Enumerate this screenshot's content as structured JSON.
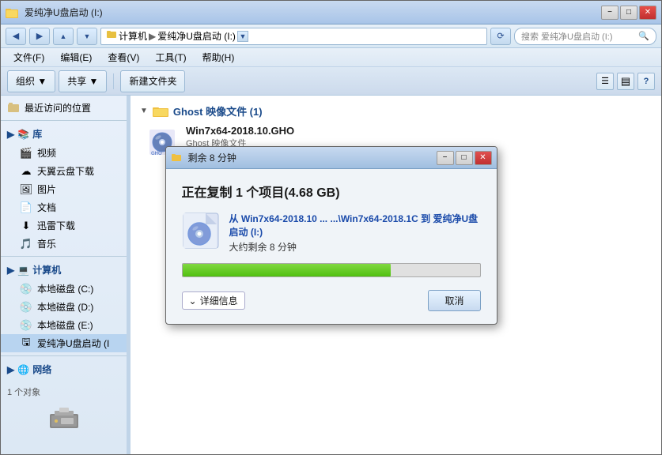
{
  "window": {
    "title": "爱纯净U盘启动 (I:)",
    "search_placeholder": "搜索 爱纯净U盘启动 (I:)"
  },
  "address": {
    "path": "计算机 ▶ 爱纯净U盘启动 (I:)"
  },
  "menu": {
    "items": [
      "文件(F)",
      "编辑(E)",
      "查看(V)",
      "工具(T)",
      "帮助(H)"
    ]
  },
  "toolbar": {
    "organize_label": "组织 ▼",
    "share_label": "共享 ▼",
    "new_folder_label": "新建文件夹"
  },
  "sidebar": {
    "recent_label": "最近访问的位置",
    "library_label": "库",
    "video_label": "视频",
    "tianyun_label": "天翼云盘下载",
    "picture_label": "图片",
    "document_label": "文档",
    "xunlei_label": "迅雷下载",
    "music_label": "音乐",
    "computer_label": "计算机",
    "disk_c_label": "本地磁盘 (C:)",
    "disk_d_label": "本地磁盘 (D:)",
    "disk_e_label": "本地磁盘 (E:)",
    "usb_label": "爱纯净U盘启动 (I",
    "network_label": "网络",
    "status_text": "1 个对象"
  },
  "files": {
    "folder_name": "Ghost 映像文件 (1)",
    "file_name": "Win7x64-2018.10.GHO",
    "file_type": "Ghost 映像文件",
    "file_size": "4.68 GB"
  },
  "dialog": {
    "title": "剩余 8 分钟",
    "main_text": "正在复制 1 个项目(4.68 GB)",
    "from_label": "从",
    "from_path": "Win7x64-2018.10 ...",
    "to_label": "到",
    "to_path": "...\\Win7x64-2018.1C",
    "dest_drive": "爱纯净U盘启动 (I:)",
    "time_label": "大约剩余 8 分钟",
    "progress_percent": 70,
    "details_label": "详细信息",
    "cancel_label": "取消",
    "minimize_label": "−",
    "restore_label": "□",
    "close_label": "✕",
    "copy_text": "从 Win7x64-2018.10 ...\\Win7x64-2018.1C 到 爱纯净U盘启动 (I:)"
  },
  "icons": {
    "back": "◀",
    "forward": "▶",
    "up": "▲",
    "chevron_down": "▼",
    "search": "🔍",
    "folder": "📁",
    "arrow_right": "▶",
    "triangle_down": "▼",
    "expand": "▼",
    "collapse": "▲",
    "computer": "💻",
    "network": "🌐",
    "disk": "💾",
    "usb": "🖫",
    "library": "📚",
    "video": "🎬",
    "cloud": "☁",
    "picture": "🖼",
    "document": "📄",
    "music": "🎵"
  }
}
